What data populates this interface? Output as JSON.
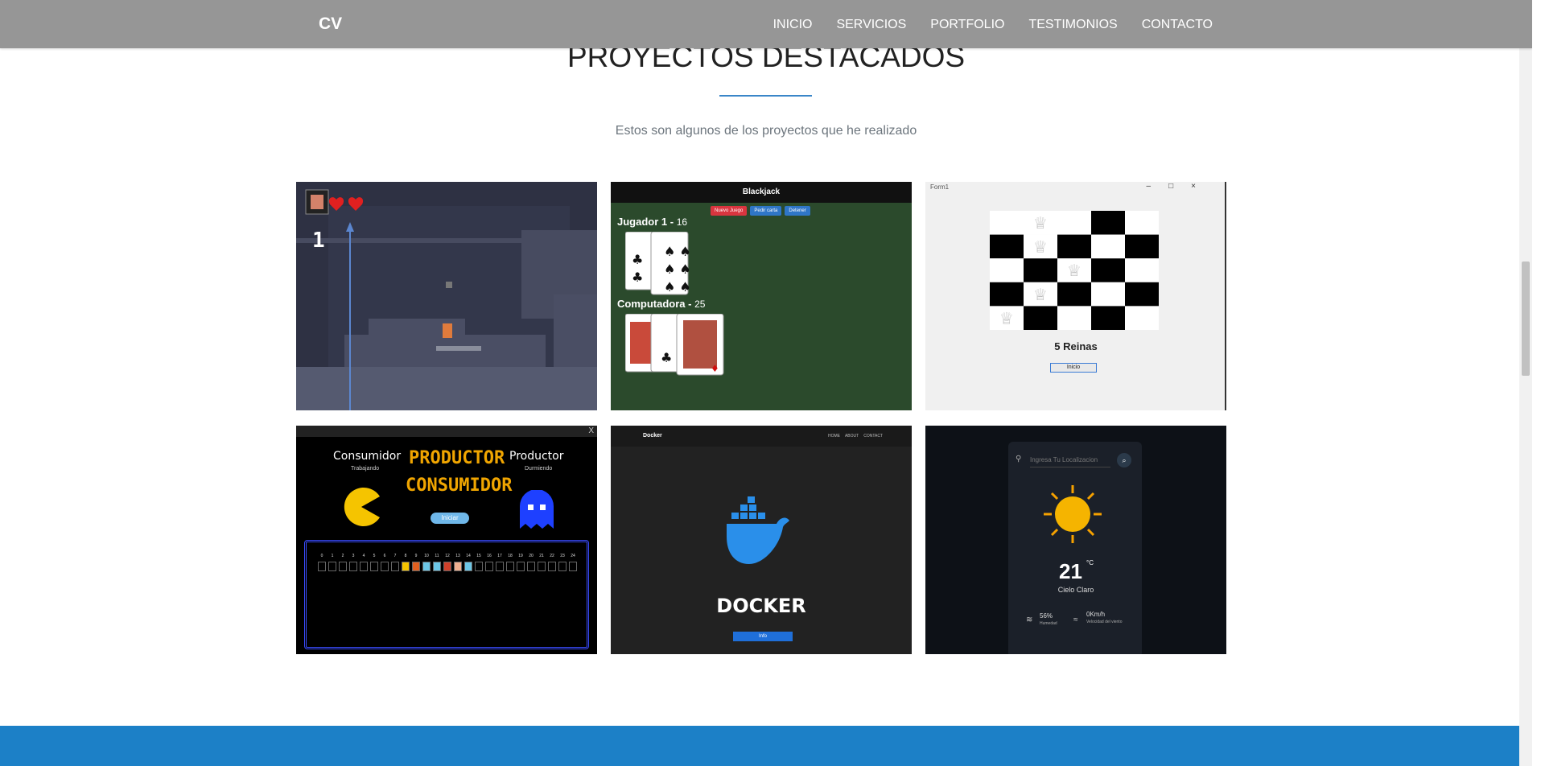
{
  "navbar": {
    "brand": "CV",
    "links": [
      "INICIO",
      "SERVICIOS",
      "PORTFOLIO",
      "TESTIMONIOS",
      "CONTACTO"
    ]
  },
  "section": {
    "title": "PROYECTOS DESTACADOS",
    "subtitle": "Estos son algunos de los proyectos que he realizado"
  },
  "projects": {
    "platformer": {
      "score": "1"
    },
    "blackjack": {
      "title": "Blackjack",
      "buttons": [
        "Nuevo Juego",
        "Pedir carta",
        "Detener"
      ],
      "player_label": "Jugador 1 - ",
      "player_score": "16",
      "computer_label": "Computadora - ",
      "computer_score": "25"
    },
    "queens": {
      "window_title": "Form1",
      "label": "5 Reinas",
      "button": "Inicio"
    },
    "prodcons": {
      "close": "X",
      "consumer_title": "Consumidor",
      "consumer_status": "Trabajando",
      "title_line1": "PRODUCTOR",
      "title_line2": "CONSUMIDOR",
      "producer_title": "Productor",
      "producer_status": "Durmiendo",
      "start_button": "Iniciar",
      "slots": [
        "0",
        "1",
        "2",
        "3",
        "4",
        "5",
        "6",
        "7",
        "8",
        "9",
        "10",
        "11",
        "12",
        "13",
        "14",
        "15",
        "16",
        "17",
        "18",
        "19",
        "20",
        "21",
        "22",
        "23",
        "24"
      ]
    },
    "docker": {
      "nav_logo": "Docker",
      "nav_links": [
        "HOME",
        "ABOUT",
        "CONTACT"
      ],
      "title": "DOCKER",
      "button": "Info"
    },
    "weather": {
      "search_placeholder": "Ingresa Tu Localizacion",
      "temperature": "21",
      "unit": "°C",
      "description": "Cielo Claro",
      "humidity_value": "56%",
      "humidity_label": "Humedad",
      "wind_value": "0Km/h",
      "wind_label": "Velocidad del viento"
    }
  },
  "colors": {
    "navbar": "#969696",
    "accent": "#3a86c8",
    "footer": "#1c80c7"
  }
}
